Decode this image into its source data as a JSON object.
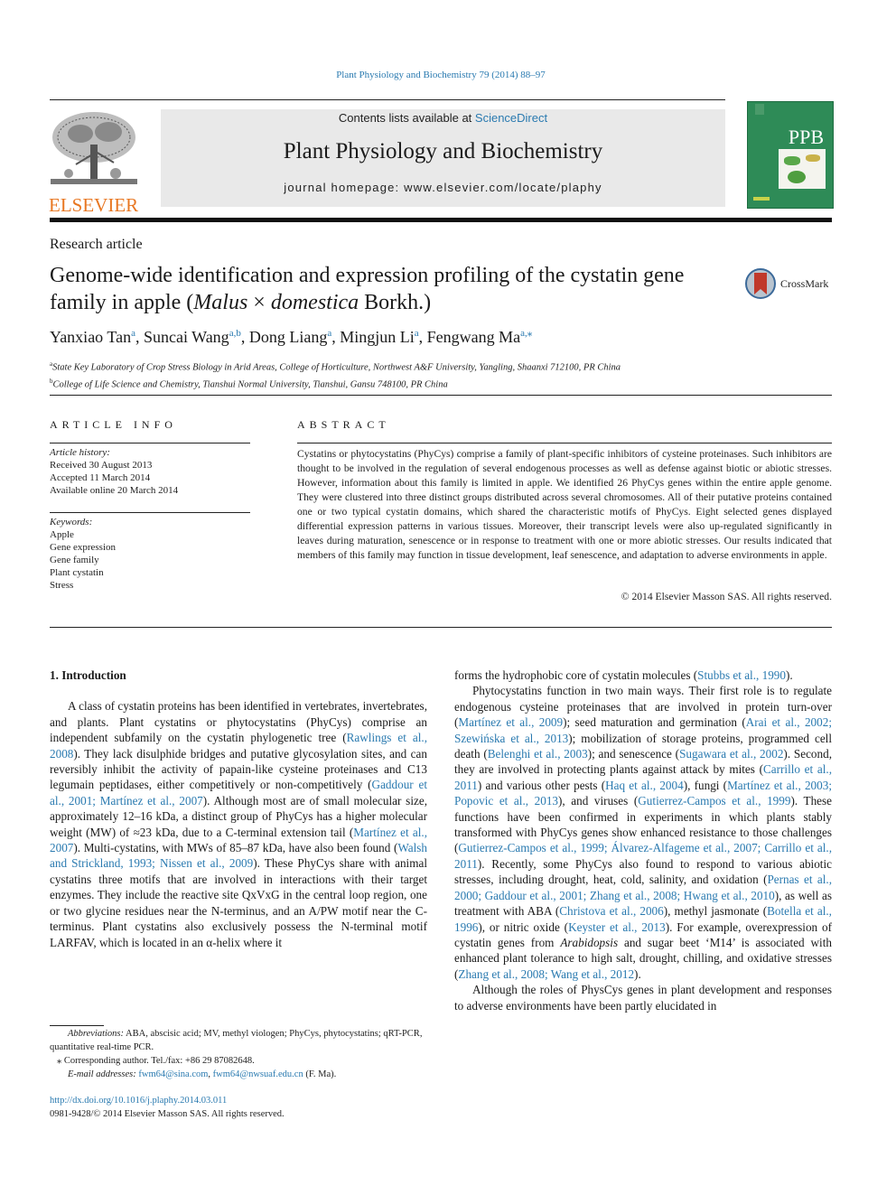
{
  "header": {
    "journal_reference": "Plant Physiology and Biochemistry 79 (2014) 88–97",
    "contents_prefix": "Contents lists available at ",
    "contents_link": "ScienceDirect",
    "journal_title": "Plant Physiology and Biochemistry",
    "homepage": "journal homepage: www.elsevier.com/locate/plaphy",
    "publisher_logo_text": "ELSEVIER",
    "cover_text": "PPB",
    "crossmark_label": "CrossMark"
  },
  "article": {
    "type": "Research article",
    "title_part1": "Genome-wide identification and expression profiling of the cystatin gene family in apple (",
    "title_species_genus": "Malus",
    "title_times": " × ",
    "title_species_epithet": "domestica",
    "title_part2": " Borkh.)",
    "authors": [
      {
        "name": "Yanxiao Tan",
        "sup": "a"
      },
      {
        "name": "Suncai Wang",
        "sup": "a,b"
      },
      {
        "name": "Dong Liang",
        "sup": "a"
      },
      {
        "name": "Mingjun Li",
        "sup": "a"
      },
      {
        "name": "Fengwang Ma",
        "sup": "a,⁎"
      }
    ],
    "affiliations": [
      {
        "key": "a",
        "text": "State Key Laboratory of Crop Stress Biology in Arid Areas, College of Horticulture, Northwest A&F University, Yangling, Shaanxi 712100, PR China"
      },
      {
        "key": "b",
        "text": "College of Life Science and Chemistry, Tianshui Normal University, Tianshui, Gansu 748100, PR China"
      }
    ]
  },
  "article_info": {
    "heading": "ARTICLE INFO",
    "history_label": "Article history:",
    "history": [
      "Received 30 August 2013",
      "Accepted 11 March 2014",
      "Available online 20 March 2014"
    ],
    "keywords_label": "Keywords:",
    "keywords": [
      "Apple",
      "Gene expression",
      "Gene family",
      "Plant cystatin",
      "Stress"
    ]
  },
  "abstract": {
    "heading": "ABSTRACT",
    "text": "Cystatins or phytocystatins (PhyCys) comprise a family of plant-specific inhibitors of cysteine proteinases. Such inhibitors are thought to be involved in the regulation of several endogenous processes as well as defense against biotic or abiotic stresses. However, information about this family is limited in apple. We identified 26 PhyCys genes within the entire apple genome. They were clustered into three distinct groups distributed across several chromosomes. All of their putative proteins contained one or two typical cystatin domains, which shared the characteristic motifs of PhyCys. Eight selected genes displayed differential expression patterns in various tissues. Moreover, their transcript levels were also up-regulated significantly in leaves during maturation, senescence or in response to treatment with one or more abiotic stresses. Our results indicated that members of this family may function in tissue development, leaf senescence, and adaptation to adverse environments in apple.",
    "copyright": "© 2014 Elsevier Masson SAS. All rights reserved."
  },
  "body": {
    "section_title": "1.  Introduction",
    "left_para1": [
      {
        "t": "A class of cystatin proteins has been identified in vertebrates, invertebrates, and plants. Plant cystatins or phytocystatins (PhyCys) comprise an independent subfamily on the cystatin phylogenetic tree ("
      },
      {
        "l": "Rawlings et al., 2008"
      },
      {
        "t": "). They lack disulphide bridges and putative glycosylation sites, and can reversibly inhibit the activity of papain-like cysteine proteinases and C13 legumain peptidases, either competitively or non-competitively ("
      },
      {
        "l": "Gaddour et al., 2001; Martínez et al., 2007"
      },
      {
        "t": "). Although most are of small molecular size, approximately 12–16 kDa, a distinct group of PhyCys has a higher molecular weight (MW) of ≈23 kDa, due to a C-terminal extension tail ("
      },
      {
        "l": "Martínez et al., 2007"
      },
      {
        "t": "). Multi-cystatins, with MWs of 85–87 kDa, have also been found ("
      },
      {
        "l": "Walsh and Strickland, 1993; Nissen et al., 2009"
      },
      {
        "t": "). These PhyCys share with animal cystatins three motifs that are involved in interactions with their target enzymes. They include the reactive site QxVxG in the central loop region, one or two glycine residues near the N-terminus, and an A/PW motif near the C-terminus. Plant cystatins also exclusively possess the N-terminal motif LARFAV, which is located in an α-helix where it"
      }
    ],
    "right_para0": [
      {
        "t": "forms the hydrophobic core of cystatin molecules ("
      },
      {
        "l": "Stubbs et al., 1990"
      },
      {
        "t": ")."
      }
    ],
    "right_para1": [
      {
        "t": "Phytocystatins function in two main ways. Their first role is to regulate endogenous cysteine proteinases that are involved in protein turn-over ("
      },
      {
        "l": "Martínez et al., 2009"
      },
      {
        "t": "); seed maturation and germination ("
      },
      {
        "l": "Arai et al., 2002; Szewińska et al., 2013"
      },
      {
        "t": "); mobilization of storage proteins, programmed cell death ("
      },
      {
        "l": "Belenghi et al., 2003"
      },
      {
        "t": "); and senescence ("
      },
      {
        "l": "Sugawara et al., 2002"
      },
      {
        "t": "). Second, they are involved in protecting plants against attack by mites ("
      },
      {
        "l": "Carrillo et al., 2011"
      },
      {
        "t": ") and various other pests ("
      },
      {
        "l": "Haq et al., 2004"
      },
      {
        "t": "), fungi ("
      },
      {
        "l": "Martínez et al., 2003; Popovic et al., 2013"
      },
      {
        "t": "), and viruses ("
      },
      {
        "l": "Gutierrez-Campos et al., 1999"
      },
      {
        "t": "). These functions have been confirmed in experiments in which plants stably transformed with PhyCys genes show enhanced resistance to those challenges ("
      },
      {
        "l": "Gutierrez-Campos et al., 1999; Álvarez-Alfageme et al., 2007; Carrillo et al., 2011"
      },
      {
        "t": "). Recently, some PhyCys also found to respond to various abiotic stresses, including drought, heat, cold, salinity, and oxidation ("
      },
      {
        "l": "Pernas et al., 2000; Gaddour et al., 2001; Zhang et al., 2008; Hwang et al., 2010"
      },
      {
        "t": "), as well as treatment with ABA ("
      },
      {
        "l": "Christova et al., 2006"
      },
      {
        "t": "), methyl jasmonate ("
      },
      {
        "l": "Botella et al., 1996"
      },
      {
        "t": "), or nitric oxide ("
      },
      {
        "l": "Keyster et al., 2013"
      },
      {
        "t": "). For example, overexpression of cystatin genes from "
      },
      {
        "i": "Arabidopsis"
      },
      {
        "t": " and sugar beet ‘M14’ is associated with enhanced plant tolerance to high salt, drought, chilling, and oxidative stresses ("
      },
      {
        "l": "Zhang et al., 2008; Wang et al., 2012"
      },
      {
        "t": ")."
      }
    ],
    "right_para2": [
      {
        "t": "Although the roles of PhysCys genes in plant development and responses to adverse environments have been partly elucidated in"
      }
    ]
  },
  "footnotes": {
    "abbrev_label": "Abbreviations:",
    "abbrev_text": " ABA, abscisic acid; MV, methyl viologen; PhyCys, phytocystatins; qRT-PCR, quantitative real-time PCR.",
    "corresponding": "⁎  Corresponding author. Tel./fax: +86 29 87082648.",
    "email_label": "E-mail addresses:",
    "email1": "fwm64@sina.com",
    "email_sep": ", ",
    "email2": "fwm64@nwsuaf.edu.cn",
    "email_suffix": " (F. Ma).",
    "doi": "http://dx.doi.org/10.1016/j.plaphy.2014.03.011",
    "issn": "0981-9428/© 2014 Elsevier Masson SAS. All rights reserved."
  },
  "colors": {
    "link": "#2a7ab0",
    "elsevier_orange": "#e87722",
    "cover_green": "#2e8b57",
    "banner_gray": "#e9e9e9"
  }
}
